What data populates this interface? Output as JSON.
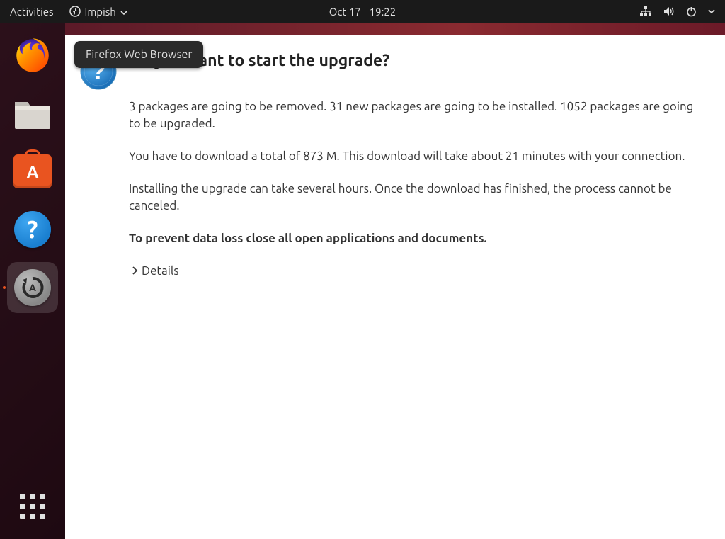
{
  "topbar": {
    "activities_label": "Activities",
    "app_name": "Impish",
    "date": "Oct 17",
    "time": "19:22"
  },
  "dock": {
    "items": [
      {
        "id": "firefox",
        "tooltip": "Firefox Web Browser"
      },
      {
        "id": "files",
        "tooltip": "Files"
      },
      {
        "id": "software",
        "tooltip": "Ubuntu Software"
      },
      {
        "id": "help",
        "tooltip": "Help"
      },
      {
        "id": "updater",
        "tooltip": "Software Updater"
      }
    ],
    "apps_label": "Show Applications"
  },
  "tooltip_text": "Firefox Web Browser",
  "dialog": {
    "title": "Do you want to start the upgrade?",
    "paragraph1": "3 packages are going to be removed. 31 new packages are going to be installed. 1052 packages are going to be upgraded.",
    "paragraph2": "You have to download a total of 873 M. This download will take about 21 minutes with your connection.",
    "paragraph3": "Installing the upgrade can take several hours. Once the download has finished, the process cannot be canceled.",
    "warning": "To prevent data loss close all open applications and documents.",
    "details_label": "Details"
  }
}
